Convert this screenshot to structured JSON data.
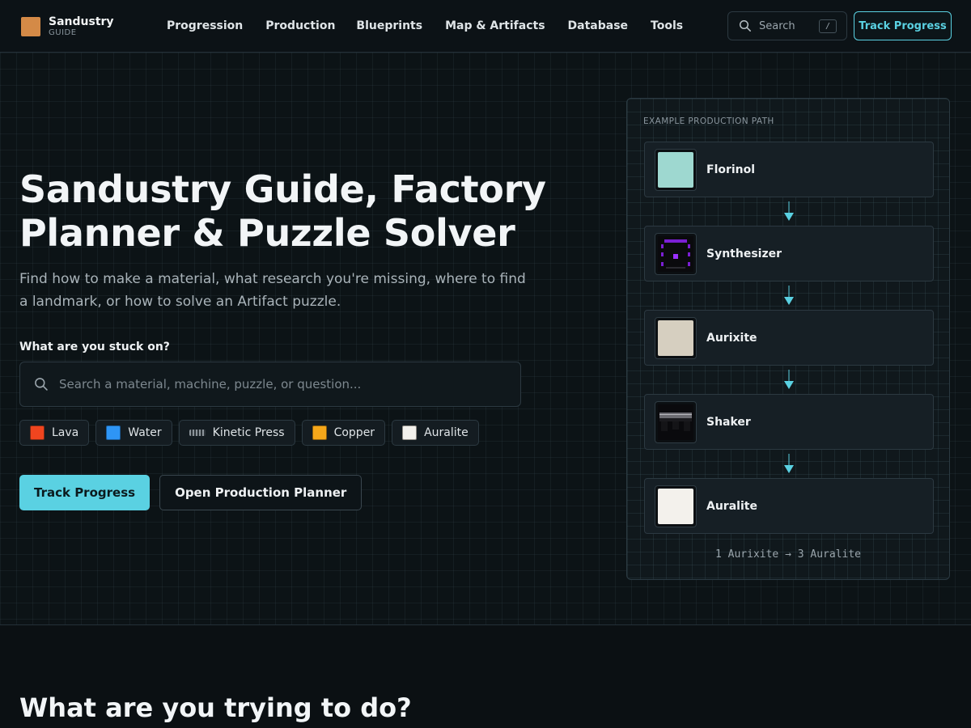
{
  "brand": {
    "name": "Sandustry",
    "sub": "GUIDE",
    "color": "#d48a47"
  },
  "nav": {
    "items": [
      {
        "label": "Progression"
      },
      {
        "label": "Production"
      },
      {
        "label": "Blueprints"
      },
      {
        "label": "Map & Artifacts"
      },
      {
        "label": "Database"
      },
      {
        "label": "Tools"
      }
    ]
  },
  "header": {
    "search_label": "Search",
    "search_shortcut": "/",
    "cta_label": "Track Progress",
    "search_icon": "search-icon"
  },
  "hero": {
    "title": "Sandustry Guide, Factory Planner & Puzzle Solver",
    "subtitle": "Find how to make a material, what research you're missing, where to find a landmark, or how to solve an Artifact puzzle.",
    "question_label": "What are you stuck on?",
    "search_placeholder": "Search a material, machine, puzzle, or question...",
    "chips": [
      {
        "label": "Lava",
        "color": "#f0451f"
      },
      {
        "label": "Water",
        "color": "#2e95f5"
      },
      {
        "label": "Kinetic Press",
        "icon": "kinetic-press-icon"
      },
      {
        "label": "Copper",
        "color": "#f5a71a"
      },
      {
        "label": "Auralite",
        "color": "#f3f1ec"
      }
    ],
    "primary_button": "Track Progress",
    "secondary_button": "Open Production Planner",
    "accent": "#5ad1e2"
  },
  "production_path": {
    "label": "Example Production Path",
    "steps": [
      {
        "name": "Florinol",
        "color": "#9ed8d0",
        "kind": "material"
      },
      {
        "name": "Synthesizer",
        "kind": "machine",
        "icon": "synthesizer-icon"
      },
      {
        "name": "Aurixite",
        "color": "#d6cfc0",
        "kind": "material"
      },
      {
        "name": "Shaker",
        "kind": "machine",
        "icon": "shaker-icon"
      },
      {
        "name": "Auralite",
        "color": "#f3f1ec",
        "kind": "material"
      }
    ],
    "footer": "1 Aurixite → 3 Auralite"
  },
  "next_section": {
    "title": "What are you trying to do?"
  }
}
